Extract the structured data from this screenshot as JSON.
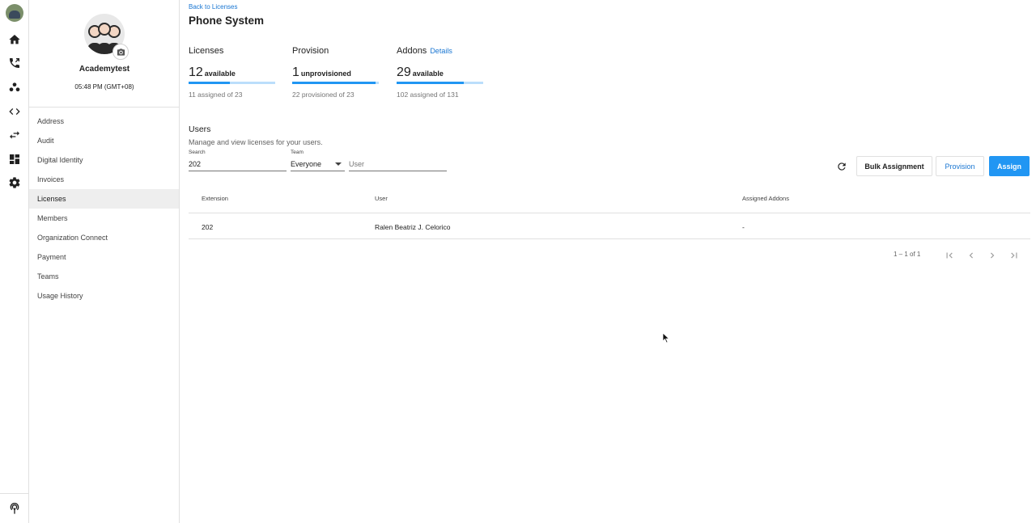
{
  "rail": {
    "icons": [
      "user-avatar",
      "home-icon",
      "phone-icon",
      "people-icon",
      "code-icon",
      "swap-icon",
      "dashboard-icon",
      "settings-icon"
    ],
    "bottom_icon": "broadcast-icon"
  },
  "org": {
    "name": "Academytest",
    "time": "05:48 PM (GMT+08)",
    "menu": [
      "Address",
      "Audit",
      "Digital Identity",
      "Invoices",
      "Licenses",
      "Members",
      "Organization Connect",
      "Payment",
      "Teams",
      "Usage History"
    ],
    "active_menu": "Licenses"
  },
  "page": {
    "back_link": "Back to Licenses",
    "title": "Phone System"
  },
  "stats": {
    "licenses": {
      "label": "Licenses",
      "value": "12",
      "unit": "available",
      "sub": "11 assigned of 23",
      "fill": 0.48
    },
    "provision": {
      "label": "Provision",
      "value": "1",
      "unit": "unprovisioned",
      "sub": "22 provisioned of 23",
      "fill": 0.96
    },
    "addons": {
      "label": "Addons",
      "details": "Details",
      "value": "29",
      "unit": "available",
      "sub": "102 assigned of 131",
      "fill": 0.78
    }
  },
  "users": {
    "title": "Users",
    "description": "Manage and view licenses for your users.",
    "search_label": "Search",
    "search_value": "202",
    "team_label": "Team",
    "team_value": "Everyone",
    "user_placeholder": "User"
  },
  "actions": {
    "bulk": "Bulk Assignment",
    "provision": "Provision",
    "assign": "Assign"
  },
  "table": {
    "headers": [
      "Extension",
      "User",
      "Assigned Addons"
    ],
    "rows": [
      {
        "extension": "202",
        "user": "Ralen Beatriz J. Celorico",
        "addons": "-"
      }
    ]
  },
  "pagination": {
    "text": "1 – 1 of 1"
  },
  "colors": {
    "accent": "#2196f3",
    "link": "#1976d2"
  }
}
